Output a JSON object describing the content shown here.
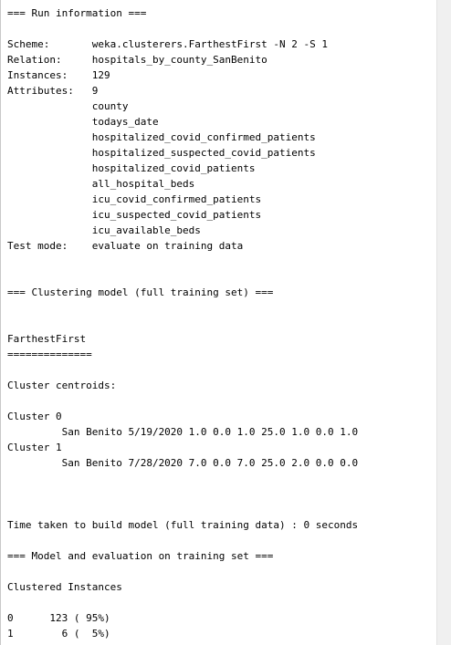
{
  "lines": [
    "=== Run information ===",
    "",
    "Scheme:       weka.clusterers.FarthestFirst -N 2 -S 1",
    "Relation:     hospitals_by_county_SanBenito",
    "Instances:    129",
    "Attributes:   9",
    "              county",
    "              todays_date",
    "              hospitalized_covid_confirmed_patients",
    "              hospitalized_suspected_covid_patients",
    "              hospitalized_covid_patients",
    "              all_hospital_beds",
    "              icu_covid_confirmed_patients",
    "              icu_suspected_covid_patients",
    "              icu_available_beds",
    "Test mode:    evaluate on training data",
    "",
    "",
    "=== Clustering model (full training set) ===",
    "",
    "",
    "FarthestFirst",
    "==============",
    "",
    "Cluster centroids:",
    "",
    "Cluster 0",
    "         San Benito 5/19/2020 1.0 0.0 1.0 25.0 1.0 0.0 1.0",
    "Cluster 1",
    "         San Benito 7/28/2020 7.0 0.0 7.0 25.0 2.0 0.0 0.0",
    "",
    "",
    "",
    "Time taken to build model (full training data) : 0 seconds",
    "",
    "=== Model and evaluation on training set ===",
    "",
    "Clustered Instances",
    "",
    "0      123 ( 95%)",
    "1        6 (  5%)"
  ]
}
